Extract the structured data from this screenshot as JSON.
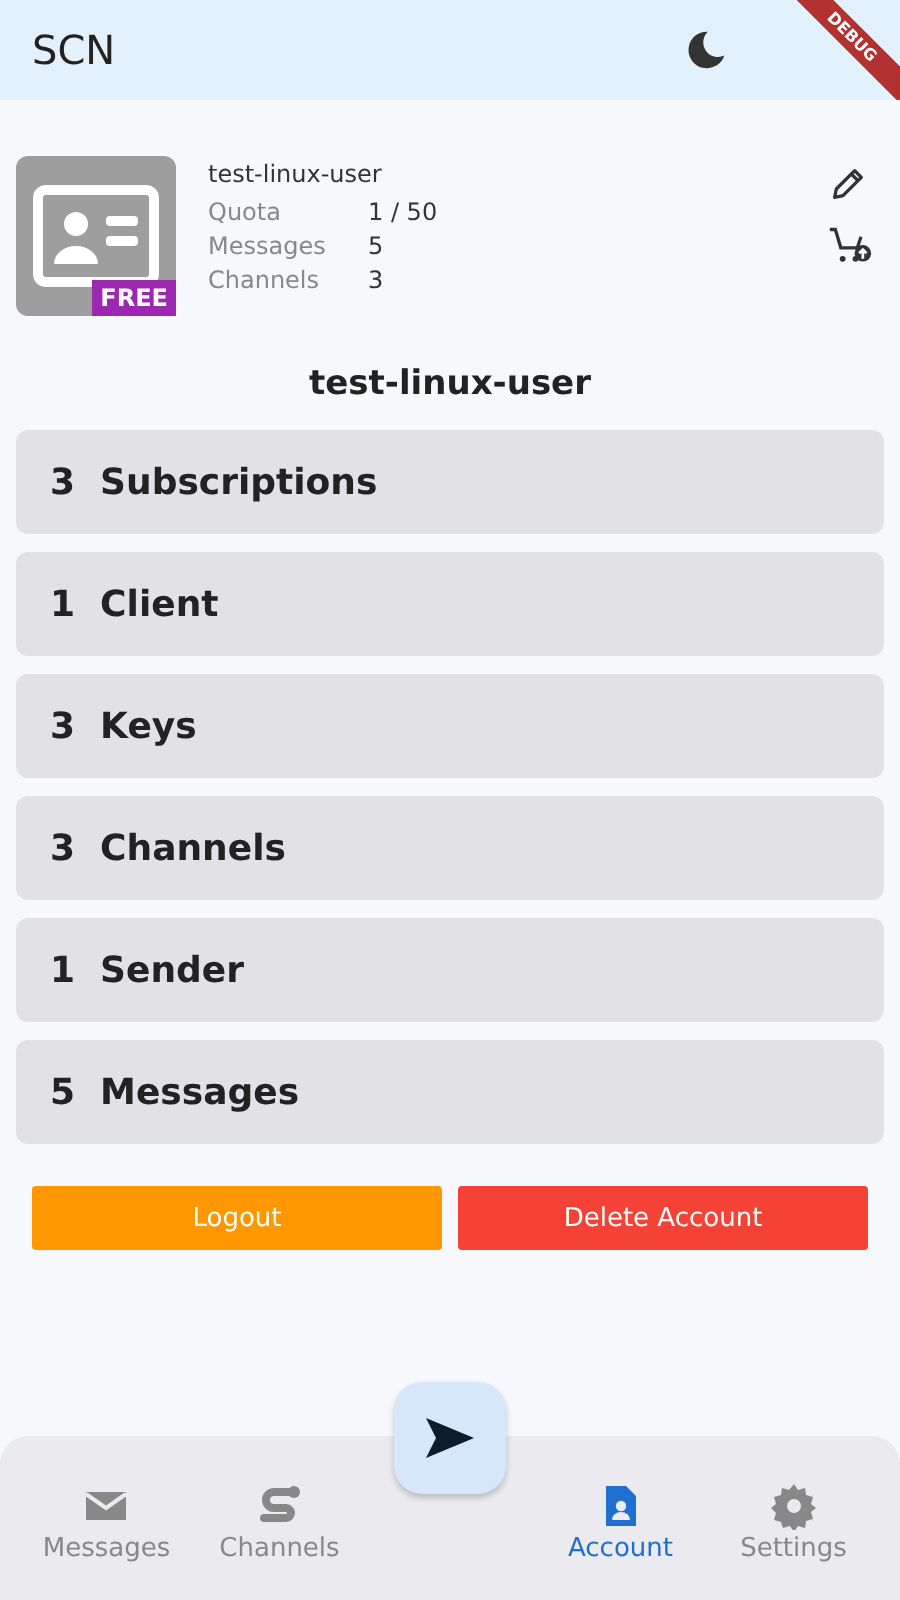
{
  "app_bar": {
    "title": "SCN",
    "debug_banner": "DEBUG"
  },
  "profile": {
    "badge": "FREE",
    "username": "test-linux-user",
    "stats": [
      {
        "label": "Quota",
        "value": "1 / 50"
      },
      {
        "label": "Messages",
        "value": "5"
      },
      {
        "label": "Channels",
        "value": "3"
      }
    ],
    "display_name": "test-linux-user"
  },
  "sections": [
    {
      "count": "3",
      "label": "Subscriptions"
    },
    {
      "count": "1",
      "label": "Client"
    },
    {
      "count": "3",
      "label": "Keys"
    },
    {
      "count": "3",
      "label": "Channels"
    },
    {
      "count": "1",
      "label": "Sender"
    },
    {
      "count": "5",
      "label": "Messages"
    }
  ],
  "buttons": [
    {
      "kind": "logout",
      "label": "Logout"
    },
    {
      "kind": "delete",
      "label": "Delete Account"
    }
  ],
  "nav": [
    {
      "kind": "messages",
      "label": "Messages",
      "selected": false
    },
    {
      "kind": "channels",
      "label": "Channels",
      "selected": false
    },
    {
      "kind": "account",
      "label": "Account",
      "selected": true
    },
    {
      "kind": "settings",
      "label": "Settings",
      "selected": false
    }
  ]
}
